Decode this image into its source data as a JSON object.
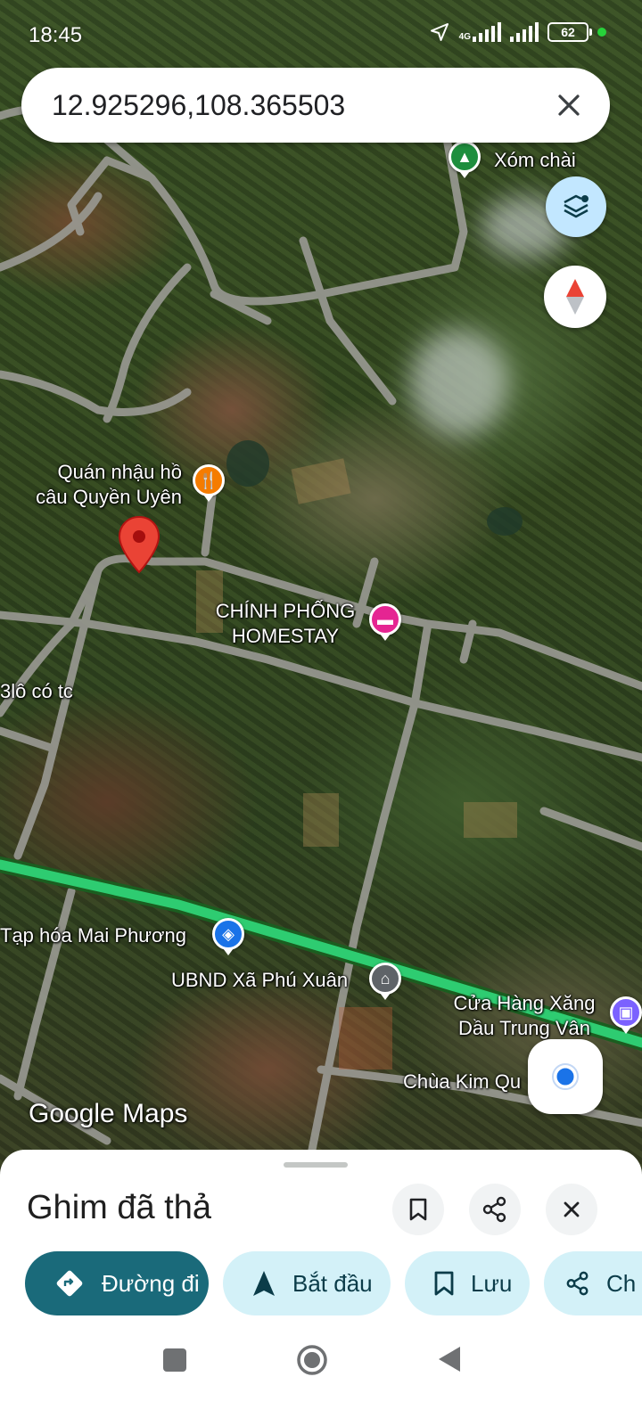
{
  "status_bar": {
    "time": "18:45",
    "network": "4G",
    "battery": "62",
    "icons": [
      "location-arrow-icon",
      "signal-icon",
      "signal-icon",
      "battery-icon"
    ]
  },
  "search": {
    "value": "12.925296,108.365503",
    "close_icon": "close-icon"
  },
  "map": {
    "attribution": "Google Maps",
    "places": [
      {
        "name": "Xóm chài",
        "icon": "park-icon",
        "color": "#1e8e3e"
      },
      {
        "name_line1": "Quán nhậu hồ",
        "name_line2": "câu Quyền Uyên",
        "icon": "restaurant-icon",
        "color": "#f57c00"
      },
      {
        "name_line1": "CHÍNH PHỐNG",
        "name_line2": "HOMESTAY",
        "icon": "hotel-icon",
        "color": "#e52592"
      },
      {
        "name": "3lô có tc"
      },
      {
        "name": "Tạp hóa Mai Phương",
        "icon": "shopping-bag-icon",
        "color": "#1a73e8"
      },
      {
        "name": "UBND Xã Phú Xuân",
        "icon": "government-icon",
        "color": "#5f6368"
      },
      {
        "name_line1": "Cửa Hàng Xăng",
        "name_line2": "Dầu Trung Vân",
        "icon": "gas-station-icon",
        "color": "#7b61ff"
      },
      {
        "name": "Chùa Kim Qu"
      }
    ],
    "controls": [
      "layers-icon",
      "compass-icon",
      "my-location-icon"
    ],
    "pin_color": "#ea4335",
    "road_highlight_color": "#2ecc71"
  },
  "sheet": {
    "title": "Ghim đã thả",
    "actions": [
      "bookmark-icon",
      "share-icon",
      "close-icon"
    ],
    "chips": [
      {
        "label": "Đường đi",
        "icon": "directions-icon"
      },
      {
        "label": "Bắt đầu",
        "icon": "navigation-arrow-icon"
      },
      {
        "label": "Lưu",
        "icon": "bookmark-icon"
      },
      {
        "label": "Ch",
        "icon": "share-icon"
      }
    ]
  },
  "nav_bar": {
    "buttons": [
      "recents-button",
      "home-button",
      "back-button"
    ]
  }
}
